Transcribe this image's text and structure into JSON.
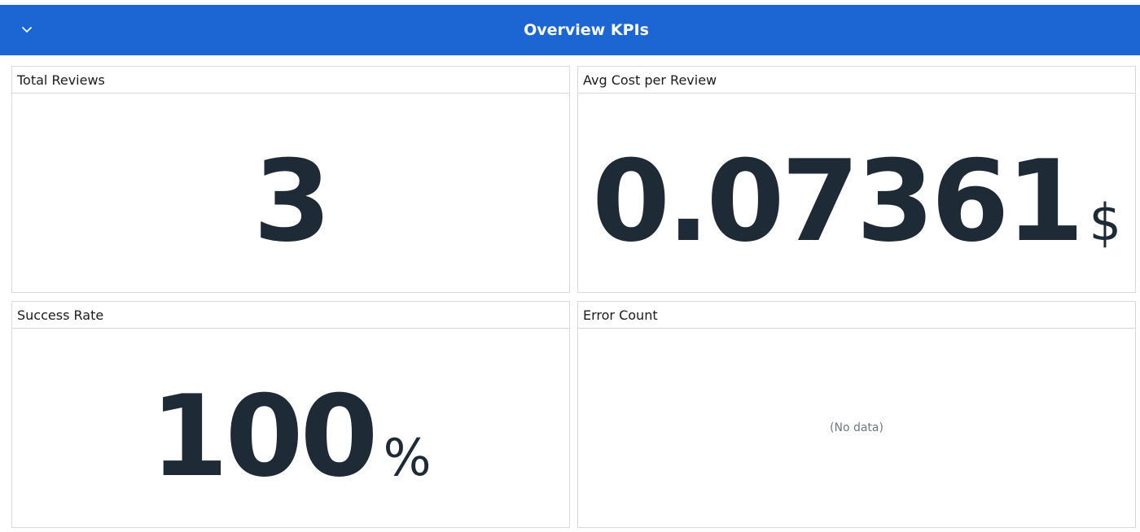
{
  "row": {
    "title": "Overview KPIs",
    "toggle_icon": "chevron-down-icon",
    "color": "#1c66d4"
  },
  "panels": {
    "total_reviews": {
      "title": "Total Reviews",
      "value": "3",
      "unit": ""
    },
    "avg_cost": {
      "title": "Avg Cost per Review",
      "value": "0.07361",
      "unit": "$"
    },
    "success_rate": {
      "title": "Success Rate",
      "value": "100",
      "unit": "%"
    },
    "error_count": {
      "title": "Error Count",
      "empty_text": "(No data)"
    }
  },
  "colors": {
    "value_text": "#1e2b36",
    "panel_border": "#d6d9dd"
  }
}
